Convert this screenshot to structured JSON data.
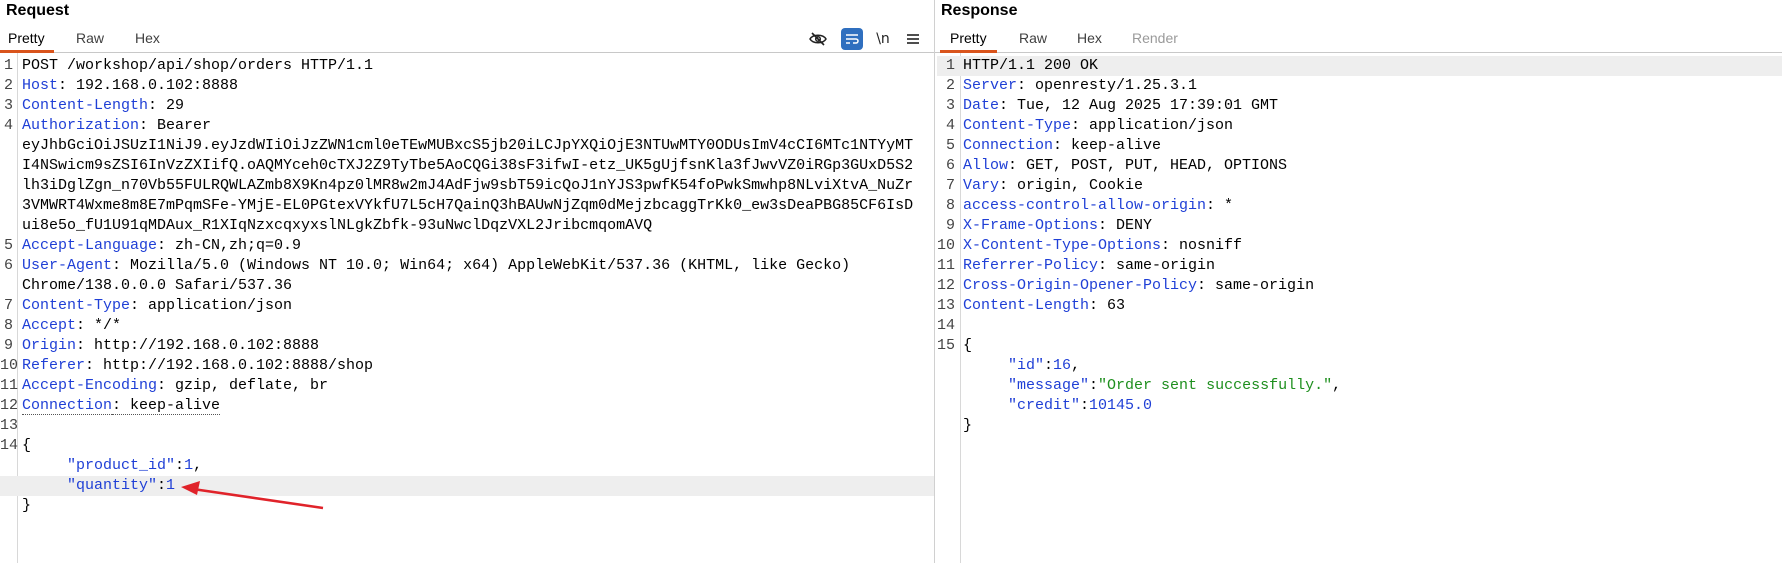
{
  "request": {
    "title": "Request",
    "tabs": [
      {
        "label": "Pretty",
        "active": true
      },
      {
        "label": "Raw",
        "active": false
      },
      {
        "label": "Hex",
        "active": false
      }
    ],
    "toolbar": {
      "hide_icon": "eye-slash-icon",
      "wrap_icon": "word-wrap-icon",
      "newline_label": "\\n",
      "menu_icon": "hamburger-menu-icon"
    },
    "lines": [
      {
        "n": "1",
        "parts": [
          {
            "t": "POST /workshop/api/shop/orders HTTP/1.1"
          }
        ]
      },
      {
        "n": "2",
        "parts": [
          {
            "t": "Host",
            "c": "hname"
          },
          {
            "t": ": 192.168.0.102:8888"
          }
        ]
      },
      {
        "n": "3",
        "parts": [
          {
            "t": "Content-Length",
            "c": "hname"
          },
          {
            "t": ": 29"
          }
        ]
      },
      {
        "n": "4",
        "parts": [
          {
            "t": "Authorization",
            "c": "hname"
          },
          {
            "t": ": Bearer"
          }
        ]
      },
      {
        "n": "",
        "parts": [
          {
            "t": "eyJhbGciOiJSUzI1NiJ9.eyJzdWIiOiJzZWN1cml0eTEwMUBxcS5jb20iLCJpYXQiOjE3NTUwMTY0ODUsImV4cCI6MTc1NTYyMT"
          }
        ]
      },
      {
        "n": "",
        "parts": [
          {
            "t": "I4NSwicm9sZSI6InVzZXIifQ.oAQMYceh0cTXJ2Z9TyTbe5AoCQGi38sF3ifwI-etz_UK5gUjfsnKla3fJwvVZ0iRGp3GUxD5S2"
          }
        ]
      },
      {
        "n": "",
        "parts": [
          {
            "t": "lh3iDglZgn_n70Vb55FULRQWLAZmb8X9Kn4pz0lMR8w2mJ4AdFjw9sbT59icQoJ1nYJS3pwfK54foPwkSmwhp8NLviXtvA_NuZr"
          }
        ]
      },
      {
        "n": "",
        "parts": [
          {
            "t": "3VMWRT4Wxme8m8E7mPqmSFe-YMjE-EL0PGtexVYkfU7L5cH7QainQ3hBAUwNjZqm0dMejzbcaggTrKk0_ew3sDeaPBG85CF6IsD"
          }
        ]
      },
      {
        "n": "",
        "parts": [
          {
            "t": "ui8e5o_fU1U91qMDAux_R1XIqNzxcqxyxslNLgkZbfk-93uNwclDqzVXL2JribcmqomAVQ"
          }
        ]
      },
      {
        "n": "5",
        "parts": [
          {
            "t": "Accept-Language",
            "c": "hname"
          },
          {
            "t": ": zh-CN,zh;q=0.9"
          }
        ]
      },
      {
        "n": "6",
        "parts": [
          {
            "t": "User-Agent",
            "c": "hname"
          },
          {
            "t": ": Mozilla/5.0 (Windows NT 10.0; Win64; x64) AppleWebKit/537.36 (KHTML, like Gecko)"
          }
        ]
      },
      {
        "n": "",
        "parts": [
          {
            "t": "Chrome/138.0.0.0 Safari/537.36"
          }
        ]
      },
      {
        "n": "7",
        "parts": [
          {
            "t": "Content-Type",
            "c": "hname"
          },
          {
            "t": ": application/json"
          }
        ]
      },
      {
        "n": "8",
        "parts": [
          {
            "t": "Accept",
            "c": "hname"
          },
          {
            "t": ": */*"
          }
        ]
      },
      {
        "n": "9",
        "parts": [
          {
            "t": "Origin",
            "c": "hname"
          },
          {
            "t": ": http://192.168.0.102:8888"
          }
        ]
      },
      {
        "n": "10",
        "parts": [
          {
            "t": "Referer",
            "c": "hname"
          },
          {
            "t": ": http://192.168.0.102:8888/shop"
          }
        ]
      },
      {
        "n": "11",
        "parts": [
          {
            "t": "Accept-Encoding",
            "c": "hname"
          },
          {
            "t": ": gzip, deflate, br"
          }
        ]
      },
      {
        "n": "12",
        "parts": [
          {
            "t": "Connection",
            "c": "hname dotted"
          },
          {
            "t": ": keep-alive",
            "c": "dotted"
          }
        ]
      },
      {
        "n": "13",
        "parts": []
      },
      {
        "n": "14",
        "parts": [
          {
            "t": "{"
          }
        ]
      },
      {
        "n": "",
        "parts": [
          {
            "t": "     "
          },
          {
            "t": "\"product_id\"",
            "c": "jkey"
          },
          {
            "t": ":"
          },
          {
            "t": "1",
            "c": "jnum"
          },
          {
            "t": ","
          }
        ]
      },
      {
        "n": "",
        "hl": true,
        "parts": [
          {
            "t": "     "
          },
          {
            "t": "\"quantity\"",
            "c": "jkey"
          },
          {
            "t": ":"
          },
          {
            "t": "1",
            "c": "jnum"
          }
        ]
      },
      {
        "n": "",
        "parts": [
          {
            "t": "}"
          }
        ]
      }
    ]
  },
  "response": {
    "title": "Response",
    "tabs": [
      {
        "label": "Pretty",
        "active": true
      },
      {
        "label": "Raw",
        "active": false
      },
      {
        "label": "Hex",
        "active": false
      },
      {
        "label": "Render",
        "active": false,
        "disabled": true
      }
    ],
    "lines": [
      {
        "n": "1",
        "hl": true,
        "parts": [
          {
            "t": "HTTP/1.1 200 OK"
          }
        ]
      },
      {
        "n": "2",
        "parts": [
          {
            "t": "Server",
            "c": "hname"
          },
          {
            "t": ": openresty/1.25.3.1"
          }
        ]
      },
      {
        "n": "3",
        "parts": [
          {
            "t": "Date",
            "c": "hname"
          },
          {
            "t": ": Tue, 12 Aug 2025 17:39:01 GMT"
          }
        ]
      },
      {
        "n": "4",
        "parts": [
          {
            "t": "Content-Type",
            "c": "hname"
          },
          {
            "t": ": application/json"
          }
        ]
      },
      {
        "n": "5",
        "parts": [
          {
            "t": "Connection",
            "c": "hname"
          },
          {
            "t": ": keep-alive"
          }
        ]
      },
      {
        "n": "6",
        "parts": [
          {
            "t": "Allow",
            "c": "hname"
          },
          {
            "t": ": GET, POST, PUT, HEAD, OPTIONS"
          }
        ]
      },
      {
        "n": "7",
        "parts": [
          {
            "t": "Vary",
            "c": "hname"
          },
          {
            "t": ": origin, Cookie"
          }
        ]
      },
      {
        "n": "8",
        "parts": [
          {
            "t": "access-control-allow-origin",
            "c": "hname"
          },
          {
            "t": ": *"
          }
        ]
      },
      {
        "n": "9",
        "parts": [
          {
            "t": "X-Frame-Options",
            "c": "hname"
          },
          {
            "t": ": DENY"
          }
        ]
      },
      {
        "n": "10",
        "parts": [
          {
            "t": "X-Content-Type-Options",
            "c": "hname"
          },
          {
            "t": ": nosniff"
          }
        ]
      },
      {
        "n": "11",
        "parts": [
          {
            "t": "Referrer-Policy",
            "c": "hname"
          },
          {
            "t": ": same-origin"
          }
        ]
      },
      {
        "n": "12",
        "parts": [
          {
            "t": "Cross-Origin-Opener-Policy",
            "c": "hname"
          },
          {
            "t": ": same-origin"
          }
        ]
      },
      {
        "n": "13",
        "parts": [
          {
            "t": "Content-Length",
            "c": "hname"
          },
          {
            "t": ": 63"
          }
        ]
      },
      {
        "n": "14",
        "parts": []
      },
      {
        "n": "15",
        "parts": [
          {
            "t": "{"
          }
        ]
      },
      {
        "n": "",
        "parts": [
          {
            "t": "     "
          },
          {
            "t": "\"id\"",
            "c": "jkey"
          },
          {
            "t": ":"
          },
          {
            "t": "16",
            "c": "jnum"
          },
          {
            "t": ","
          }
        ]
      },
      {
        "n": "",
        "parts": [
          {
            "t": "     "
          },
          {
            "t": "\"message\"",
            "c": "jkey"
          },
          {
            "t": ":"
          },
          {
            "t": "\"Order sent successfully.\"",
            "c": "jstr"
          },
          {
            "t": ","
          }
        ]
      },
      {
        "n": "",
        "parts": [
          {
            "t": "     "
          },
          {
            "t": "\"credit\"",
            "c": "jkey"
          },
          {
            "t": ":"
          },
          {
            "t": "10145.0",
            "c": "jnum"
          }
        ]
      },
      {
        "n": "",
        "parts": [
          {
            "t": "}"
          }
        ]
      }
    ]
  },
  "annotation": {
    "arrow_color": "#e0232a"
  },
  "colors": {
    "accent": "#d9541c",
    "header_name": "#1f3fd6",
    "json_string": "#1e8f1e",
    "toolbar_active": "#2f6fbf"
  }
}
